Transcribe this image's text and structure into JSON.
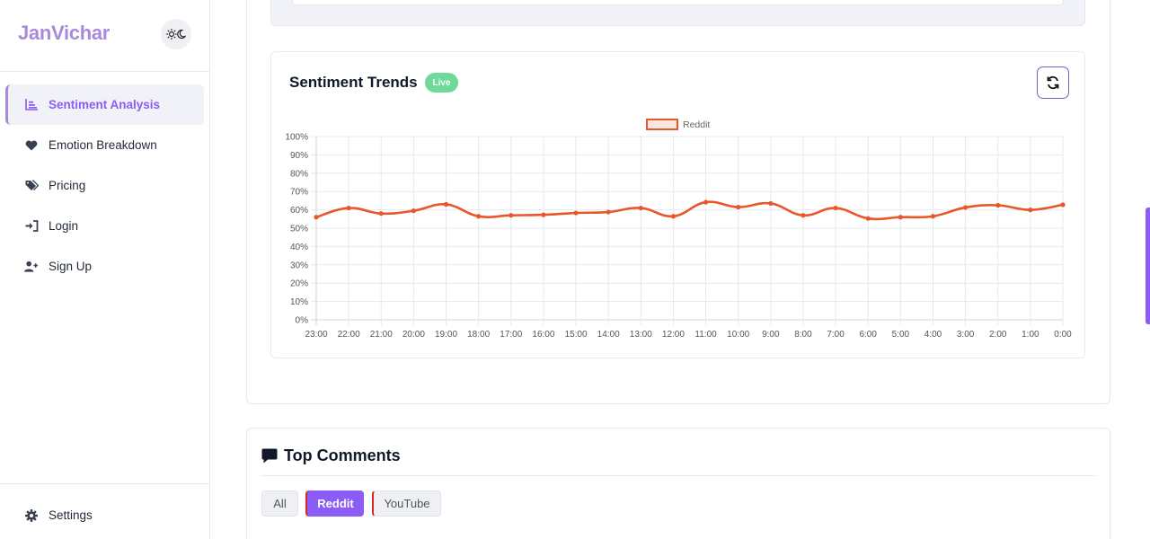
{
  "app": {
    "brand": "JanVichar"
  },
  "sidebar": {
    "items": [
      {
        "label": "Sentiment Analysis",
        "icon": "bar-chart-icon",
        "active": true
      },
      {
        "label": "Emotion Breakdown",
        "icon": "heart-icon"
      },
      {
        "label": "Pricing",
        "icon": "tags-icon"
      },
      {
        "label": "Login",
        "icon": "sign-in-icon"
      },
      {
        "label": "Sign Up",
        "icon": "user-plus-icon"
      }
    ],
    "settings": {
      "label": "Settings",
      "icon": "gear-icon"
    }
  },
  "trends": {
    "title": "Sentiment Trends",
    "badge": "Live"
  },
  "chart_data": {
    "type": "line",
    "title": "",
    "xlabel": "",
    "ylabel": "",
    "ylim": [
      0,
      100
    ],
    "yticks": [
      "0%",
      "10%",
      "20%",
      "30%",
      "40%",
      "50%",
      "60%",
      "70%",
      "80%",
      "90%",
      "100%"
    ],
    "x": [
      "23:00",
      "22:00",
      "21:00",
      "20:00",
      "19:00",
      "18:00",
      "17:00",
      "16:00",
      "15:00",
      "14:00",
      "13:00",
      "12:00",
      "11:00",
      "10:00",
      "9:00",
      "8:00",
      "7:00",
      "6:00",
      "5:00",
      "4:00",
      "3:00",
      "2:00",
      "1:00",
      "0:00"
    ],
    "grid": true,
    "legend": "top-center",
    "series": [
      {
        "name": "Reddit",
        "color": "#e8562a",
        "values": [
          56,
          61,
          58,
          59.5,
          63,
          56.5,
          57,
          57.3,
          58.3,
          58.8,
          61,
          56.5,
          64.2,
          61.5,
          63.5,
          57,
          61,
          55.3,
          56,
          56.5,
          61.3,
          62.5,
          60,
          62.8
        ]
      }
    ]
  },
  "comments": {
    "title": "Top Comments",
    "tabs": [
      {
        "label": "All"
      },
      {
        "label": "Reddit",
        "active": true
      },
      {
        "label": "YouTube"
      }
    ]
  },
  "colors": {
    "accent": "#8b5cf6",
    "brand": "#a78bdb",
    "live": "#6fd99a",
    "series": "#e8562a"
  }
}
